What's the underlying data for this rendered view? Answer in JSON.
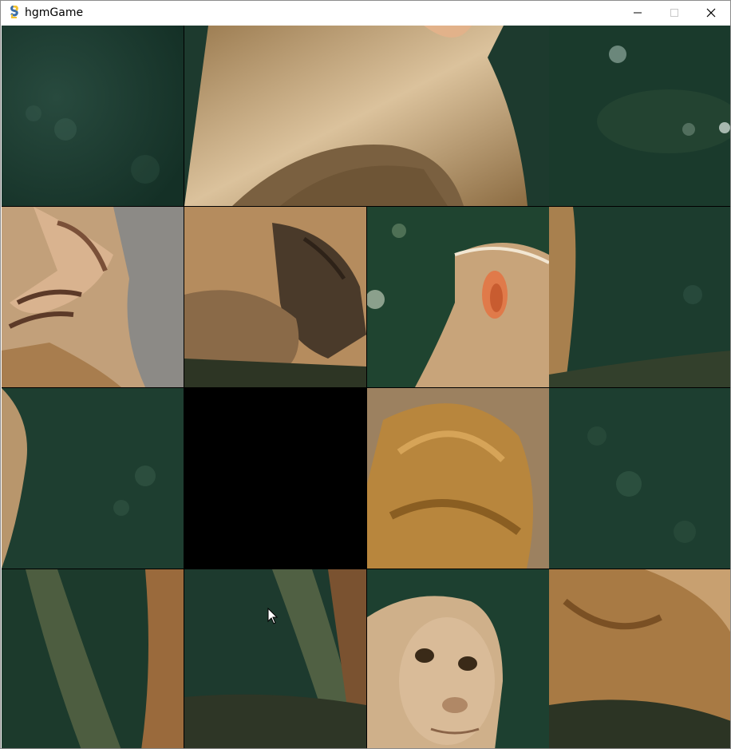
{
  "window": {
    "title": "hgmGame",
    "icon": "snake-app-icon",
    "controls": [
      "minimize-icon",
      "maximize-icon",
      "close-icon"
    ]
  },
  "puzzle": {
    "rows": 4,
    "columns": 4,
    "empty_tile": {
      "row": 3,
      "column": 2
    },
    "colors": {
      "bokeh_green": "#1f3d33",
      "dark_green": "#163026",
      "fur_light": "#c9a77a",
      "fur_gold": "#b8863d",
      "fur_dark": "#6e5536",
      "branch": "#2d3524",
      "face": "#d4b28e",
      "ear": "#e07a4a",
      "empty": "#000000"
    },
    "tiles": [
      [
        "bokeh-background",
        "monkey-chin-chest",
        "monkey-chin-chest",
        "bokeh-background"
      ],
      [
        "monkey-hand-crossed",
        "monkey-paws-on-branch",
        "monkey-head-back-ear",
        "monkey-back-edge-branch"
      ],
      [
        "monkey-fur-edge",
        "empty",
        "monkey-shoulder-fur",
        "bokeh-background"
      ],
      [
        "tree-trunk-blur",
        "branch-with-trunk",
        "monkey-face",
        "monkey-body-fur"
      ]
    ]
  }
}
